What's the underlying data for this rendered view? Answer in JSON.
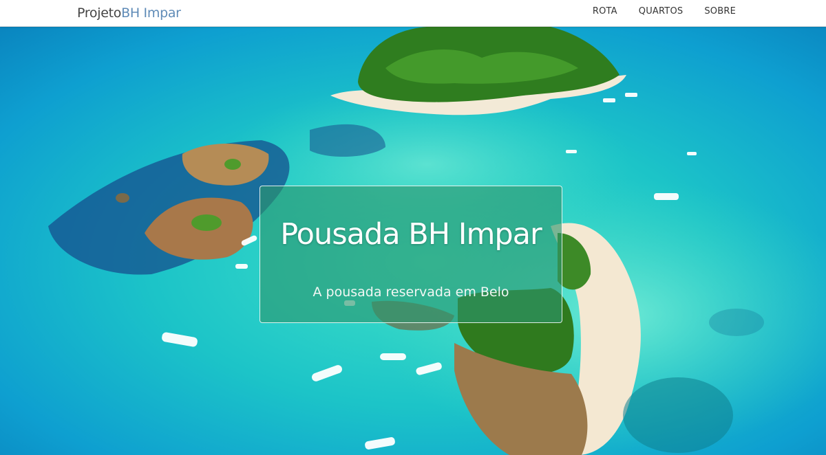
{
  "navbar": {
    "brand_prefix": "Projeto",
    "brand_accent": "BH Impar",
    "links": [
      "ROTA",
      "QUARTOS",
      "SOBRE"
    ]
  },
  "hero": {
    "title": "Pousada BH Impar",
    "subtitle": "A pousada reservada em Belo"
  },
  "colors": {
    "brand_accent": "#5f8bb7",
    "card_background": "rgba(45,150,110,0.62)",
    "sea_deep": "#0f8fc4",
    "sea_shallow": "#2fd3c0",
    "sand": "#f2e6cf",
    "forest": "#2f7d1f"
  }
}
